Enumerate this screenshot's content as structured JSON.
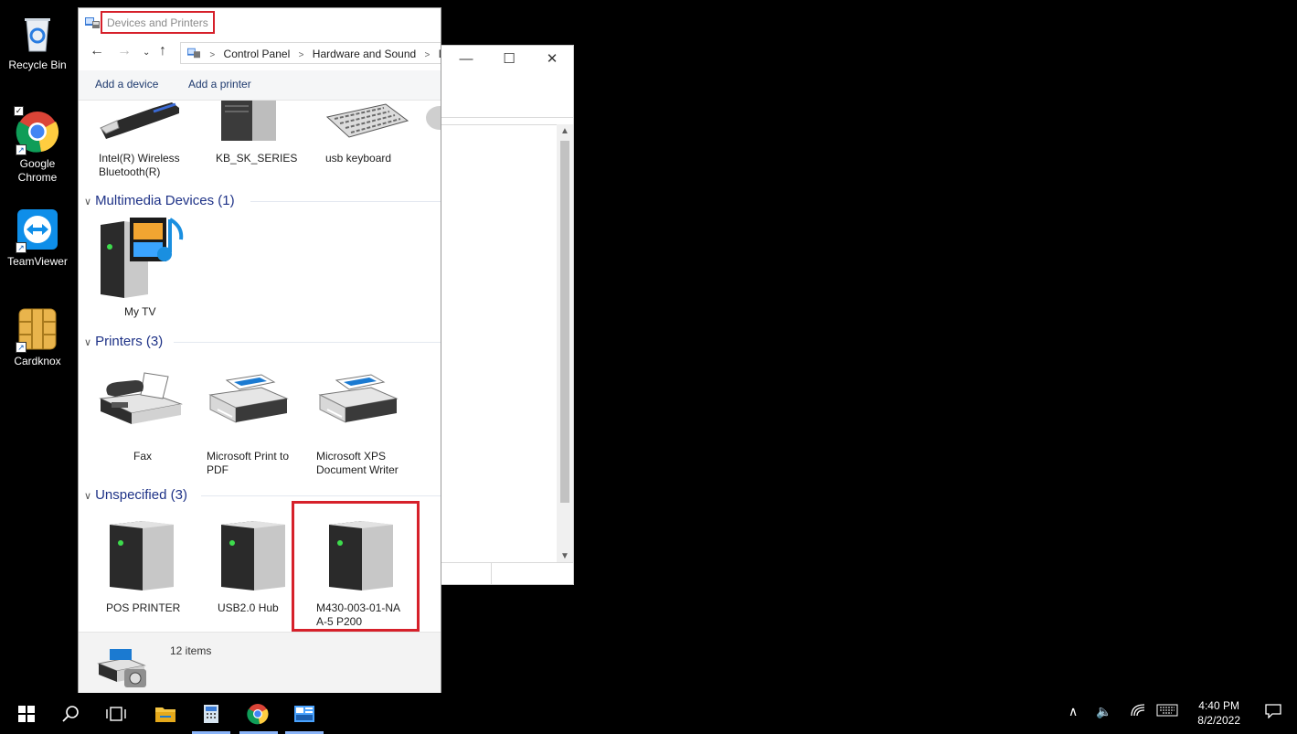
{
  "desktop": {
    "icons": [
      {
        "label": "Recycle Bin"
      },
      {
        "label": "Google Chrome"
      },
      {
        "label": "TeamViewer"
      },
      {
        "label": "Cardknox"
      }
    ]
  },
  "window": {
    "title": "Devices and Printers",
    "breadcrumb": [
      "Control Panel",
      "Hardware and Sound",
      "D"
    ],
    "toolbar": {
      "add_device": "Add a device",
      "add_printer": "Add a printer"
    },
    "top_devices": [
      {
        "label": "Intel(R) Wireless Bluetooth(R)",
        "icon": "usb-dongle-icon"
      },
      {
        "label": "KB_SK_SERIES",
        "icon": "computer-tower-icon"
      },
      {
        "label": "usb keyboard",
        "icon": "keyboard-icon"
      }
    ],
    "groups": {
      "multimedia": {
        "title": "Multimedia Devices (1)",
        "items": [
          {
            "label": "My TV",
            "icon": "media-device-icon"
          }
        ]
      },
      "printers": {
        "title": "Printers (3)",
        "items": [
          {
            "label": "Fax",
            "icon": "fax-icon"
          },
          {
            "label": "Microsoft Print to PDF",
            "icon": "printer-icon"
          },
          {
            "label": "Microsoft XPS Document Writer",
            "icon": "printer-icon"
          }
        ]
      },
      "unspecified": {
        "title": "Unspecified (3)",
        "items": [
          {
            "label": "POS PRINTER",
            "icon": "generic-device-icon"
          },
          {
            "label": "USB2.0 Hub",
            "icon": "generic-device-icon"
          },
          {
            "label": "M430-003-01-NAA-5 P200",
            "icon": "generic-device-icon"
          }
        ]
      }
    },
    "status": {
      "count": "12 items"
    }
  },
  "taskbar": {
    "time": "4:40 PM",
    "date": "8/2/2022"
  },
  "colors": {
    "highlight_red": "#d6202a",
    "group_title": "#1e3287",
    "taskbar_bg": "#000000"
  }
}
